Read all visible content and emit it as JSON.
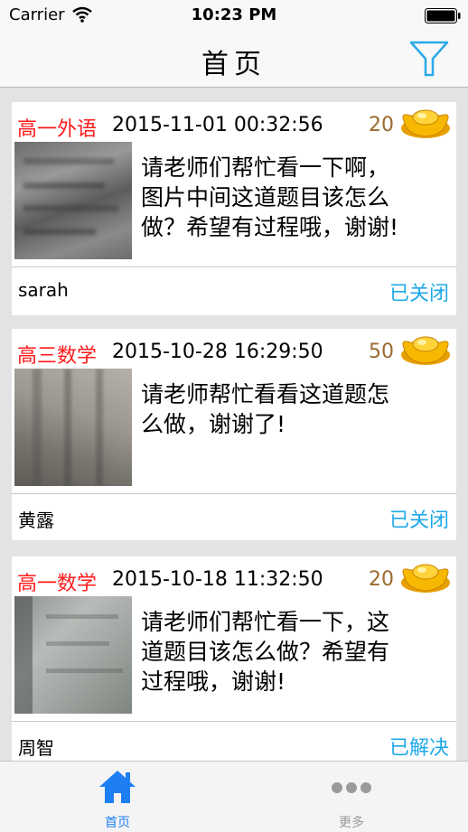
{
  "status_bar": {
    "carrier": "Carrier",
    "time": "10:23 PM"
  },
  "nav": {
    "title": "首页",
    "filter_icon": "filter-icon"
  },
  "posts": [
    {
      "subject": "高一外语",
      "datetime": "2015-11-01 00:32:56",
      "reward": "20",
      "description_lines": [
        "请老师们帮忙看一下啊，",
        "图片中间这道题目该怎么",
        "做？希望有过程哦，谢谢!"
      ],
      "author": "sarah",
      "status": "已关闭"
    },
    {
      "subject": "高三数学",
      "datetime": "2015-10-28 16:29:50",
      "reward": "50",
      "description_lines": [
        "请老师帮忙看看这道题怎",
        "么做，谢谢了!"
      ],
      "author": "黄露",
      "status": "已关闭"
    },
    {
      "subject": "高一数学",
      "datetime": "2015-10-18 11:32:50",
      "reward": "20",
      "description_lines": [
        "请老师们帮忙看一下，这",
        "道题目该怎么做？希望有",
        "过程哦，谢谢!"
      ],
      "author": "周智",
      "status": "已解决"
    }
  ],
  "tabs": [
    {
      "label": "首页",
      "icon": "home-icon",
      "active": true
    },
    {
      "label": "更多",
      "icon": "more-icon",
      "active": false
    }
  ],
  "colors": {
    "subject": "#ff1a1a",
    "reward": "#9b6a2e",
    "status": "#1ea9e8",
    "tab_active": "#1e7ff5",
    "tab_inactive": "#9a9a9a"
  }
}
